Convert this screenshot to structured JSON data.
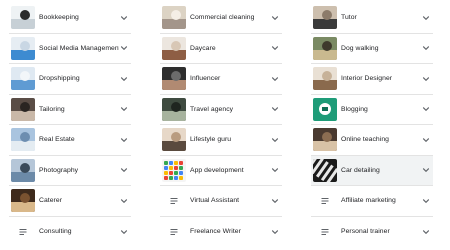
{
  "columns": [
    {
      "items": [
        {
          "label": "Bookkeeping",
          "thumb": "bookkeeping-thumbnail",
          "colors": [
            "#eef2f4",
            "#c7d0d6",
            "#2b2b2b"
          ]
        },
        {
          "label": "Social Media Management",
          "thumb": "social-media-thumbnail",
          "colors": [
            "#e6edf3",
            "#3d8bd1",
            "#c9d7e4"
          ]
        },
        {
          "label": "Dropshipping",
          "thumb": "dropshipping-thumbnail",
          "colors": [
            "#dfe9f2",
            "#5f9bd3",
            "#f2f6f9"
          ]
        },
        {
          "label": "Tailoring",
          "thumb": "tailoring-thumbnail",
          "colors": [
            "#5a4d46",
            "#c9b8a8",
            "#2a2522"
          ]
        },
        {
          "label": "Real Estate",
          "thumb": "real-estate-thumbnail",
          "colors": [
            "#a9c4df",
            "#e4ecf2",
            "#6d8eb0"
          ]
        },
        {
          "label": "Photography",
          "thumb": "photography-thumbnail",
          "colors": [
            "#b5c6d8",
            "#6c8aa8",
            "#3a4a5a"
          ]
        },
        {
          "label": "Caterer",
          "thumb": "caterer-thumbnail",
          "colors": [
            "#3e2a1c",
            "#d9b88a",
            "#7a5230"
          ]
        },
        {
          "label": "Consulting",
          "thumb": "document-icon"
        }
      ]
    },
    {
      "items": [
        {
          "label": "Commercial cleaning",
          "thumb": "commercial-cleaning-thumbnail",
          "colors": [
            "#dcd3c4",
            "#a3958a",
            "#f4eee6"
          ]
        },
        {
          "label": "Daycare",
          "thumb": "daycare-thumbnail",
          "colors": [
            "#ece6df",
            "#8e5e44",
            "#d8c7b5"
          ]
        },
        {
          "label": "Influencer",
          "thumb": "influencer-thumbnail",
          "colors": [
            "#2e2e2e",
            "#b18a72",
            "#6b6b6b"
          ]
        },
        {
          "label": "Travel agency",
          "thumb": "travel-agency-thumbnail",
          "colors": [
            "#3f4b40",
            "#a7b39e",
            "#1f2520"
          ]
        },
        {
          "label": "Lifestyle guru",
          "thumb": "lifestyle-guru-thumbnail",
          "colors": [
            "#e7d8c8",
            "#5a4a3e",
            "#b99c80"
          ]
        },
        {
          "label": "App development",
          "thumb": "app-development-thumbnail",
          "colors": [
            "#f5f5f5",
            "#34a853",
            "#4285f4",
            "#fbbc05",
            "#ea4335"
          ]
        },
        {
          "label": "Virtual Assistant",
          "thumb": "document-icon"
        },
        {
          "label": "Freelance Writer",
          "thumb": "document-icon"
        }
      ]
    },
    {
      "items": [
        {
          "label": "Tutor",
          "thumb": "tutor-thumbnail",
          "colors": [
            "#cdbfae",
            "#3a3a3a",
            "#8c7b6a"
          ]
        },
        {
          "label": "Dog walking",
          "thumb": "dog-walking-thumbnail",
          "colors": [
            "#7a8a63",
            "#c9b98f",
            "#3e3a2c"
          ]
        },
        {
          "label": "Interior Designer",
          "thumb": "interior-designer-thumbnail",
          "colors": [
            "#e9e0d4",
            "#8a6a4d",
            "#c7b299"
          ]
        },
        {
          "label": "Blogging",
          "thumb": "blogging-thumbnail",
          "colors": [
            "#1e9c78",
            "#ffffff",
            "#0f6f55"
          ]
        },
        {
          "label": "Online teaching",
          "thumb": "online-teaching-thumbnail",
          "colors": [
            "#4a3a30",
            "#d8c2a6",
            "#8b6d52"
          ]
        },
        {
          "label": "Car detailing",
          "thumb": "car-detailing-thumbnail",
          "colors": [
            "#1b1b1b",
            "#e8e8e8",
            "#555555"
          ],
          "highlighted": true
        },
        {
          "label": "Affiliate marketing",
          "thumb": "document-icon"
        },
        {
          "label": "Personal trainer",
          "thumb": "document-icon"
        }
      ]
    }
  ],
  "icons": {
    "expand": "chevron-down-icon",
    "placeholder": "document-icon"
  },
  "colors": {
    "text": "#202124",
    "divider": "#e3e3e3",
    "chevron": "#5f6368",
    "doc_icon": "#5f6368",
    "highlight": "#f1f3f4"
  }
}
